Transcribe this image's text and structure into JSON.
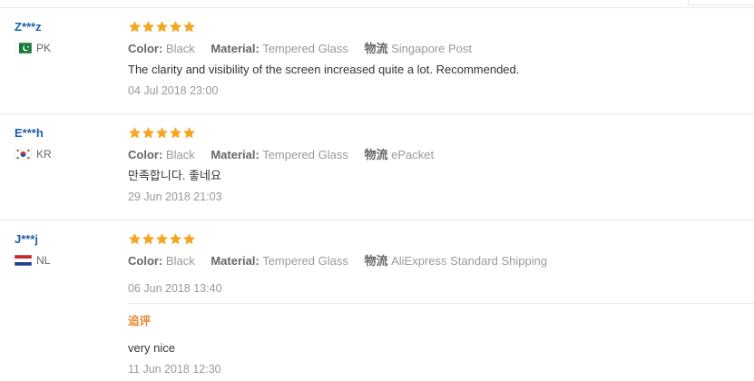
{
  "colors": {
    "buyer_name": "#1e5ea8",
    "star": "#f5a623",
    "label": "#666666",
    "value": "#999999",
    "text": "#333333",
    "additional_label": "#e8832a"
  },
  "attribute_keys": {
    "color": "Color:",
    "material": "Material:",
    "shipping": "物流"
  },
  "reviews": [
    {
      "buyer": "Z***z",
      "country_code": "PK",
      "flag_icon": "pakistan-flag-icon",
      "stars": 5,
      "color": "Black",
      "material": "Tempered Glass",
      "shipping": "Singapore Post",
      "feedback": "The clarity and visibility of the screen increased quite a lot. Recommended.",
      "date": "04 Jul 2018 23:00"
    },
    {
      "buyer": "E***h",
      "country_code": "KR",
      "flag_icon": "south-korea-flag-icon",
      "stars": 5,
      "color": "Black",
      "material": "Tempered Glass",
      "shipping": "ePacket",
      "feedback": "만족합니다. 좋네요",
      "date": "29 Jun 2018 21:03"
    },
    {
      "buyer": "J***j",
      "country_code": "NL",
      "flag_icon": "netherlands-flag-icon",
      "stars": 5,
      "color": "Black",
      "material": "Tempered Glass",
      "shipping": "AliExpress Standard Shipping",
      "feedback": "",
      "date": "06 Jun 2018 13:40",
      "additional": {
        "label": "追评",
        "feedback": "very nice",
        "date": "11 Jun 2018 12:30"
      }
    }
  ]
}
